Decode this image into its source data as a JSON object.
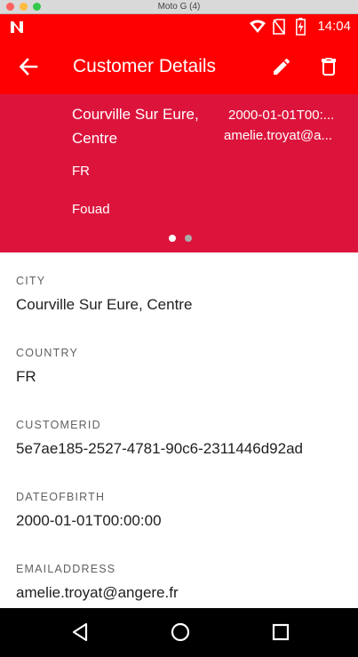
{
  "window": {
    "title": "Moto G (4)"
  },
  "status_bar": {
    "time": "14:04"
  },
  "app_bar": {
    "title": "Customer Details"
  },
  "header_card": {
    "left_line1": "Courville Sur Eure,",
    "left_line2": "Centre",
    "left_country": "FR",
    "left_name": "Fouad",
    "right_dob": "2000-01-01T00:...",
    "right_email": "amelie.troyat@a...",
    "page_count": 2,
    "active_page": 1
  },
  "fields": [
    {
      "label": "CITY",
      "value": "Courville Sur Eure, Centre"
    },
    {
      "label": "COUNTRY",
      "value": "FR"
    },
    {
      "label": "CUSTOMERID",
      "value": "5e7ae185-2527-4781-90c6-2311446d92ad"
    },
    {
      "label": "DATEOFBIRTH",
      "value": "2000-01-01T00:00:00"
    },
    {
      "label": "EMAILADDRESS",
      "value": "amelie.troyat@angere.fr"
    }
  ],
  "icons": {
    "back": "arrow-back-icon",
    "edit": "pencil-icon",
    "delete": "trash-icon",
    "nav_back": "triangle-back-icon",
    "nav_home": "circle-home-icon",
    "nav_recents": "square-recents-icon"
  },
  "colors": {
    "app_bar": "#ff0000",
    "header_card": "#dc143c",
    "nav_bar": "#000000"
  }
}
